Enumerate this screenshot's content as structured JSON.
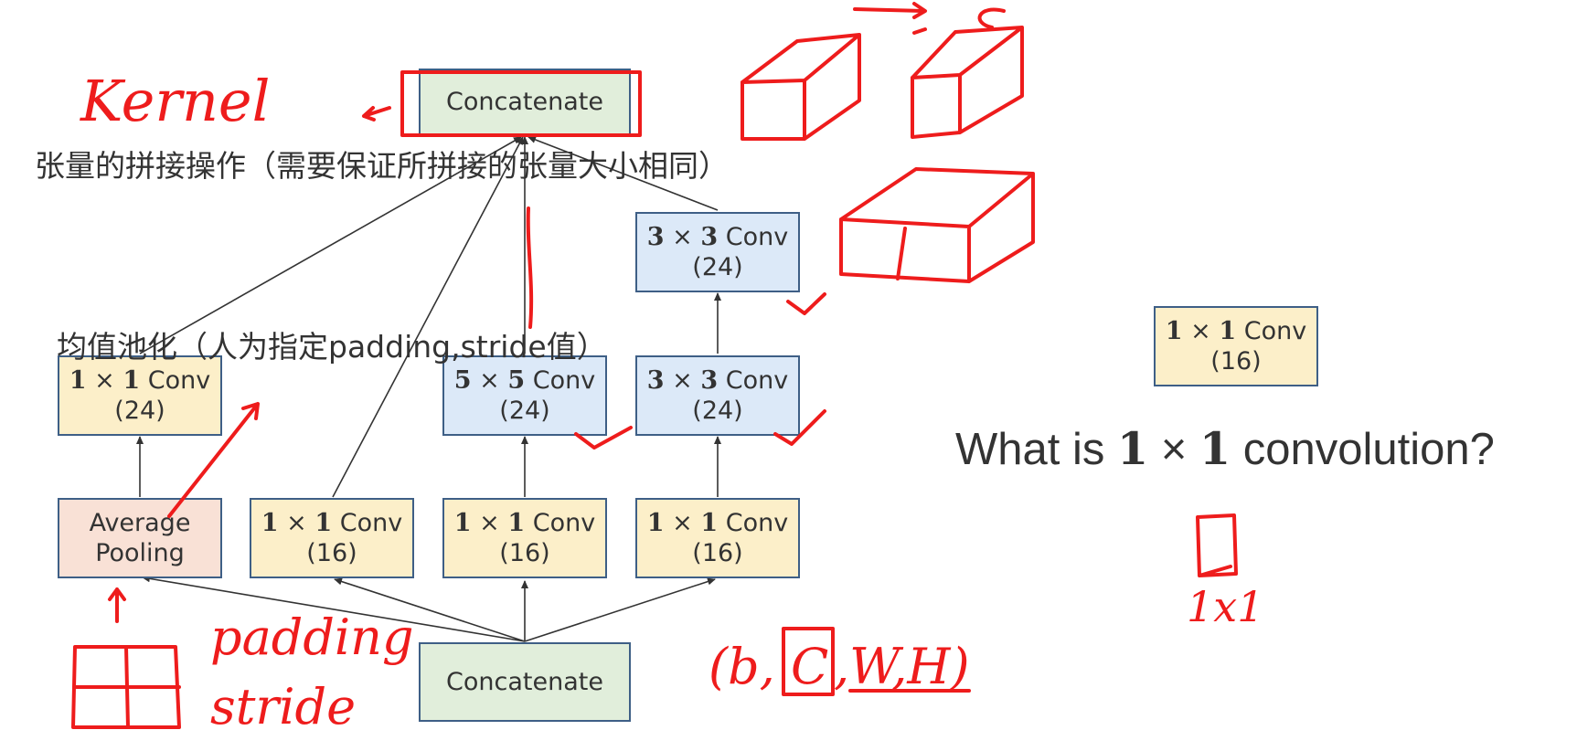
{
  "diagram": {
    "top_concat": "Concatenate",
    "bottom_concat": "Concatenate",
    "branch1_conv": {
      "num_a": "1",
      "num_b": "1",
      "label": "Conv",
      "channels": "(24)"
    },
    "avg_pool": {
      "line1": "Average",
      "line2": "Pooling"
    },
    "branch2_conv": {
      "num_a": "1",
      "num_b": "1",
      "label": "Conv",
      "channels": "(16)"
    },
    "branch3_conv1": {
      "num_a": "1",
      "num_b": "1",
      "label": "Conv",
      "channels": "(16)"
    },
    "branch3_conv5": {
      "num_a": "5",
      "num_b": "5",
      "label": "Conv",
      "channels": "(24)"
    },
    "branch4_conv1": {
      "num_a": "1",
      "num_b": "1",
      "label": "Conv",
      "channels": "(16)"
    },
    "branch4_conv3a": {
      "num_a": "3",
      "num_b": "3",
      "label": "Conv",
      "channels": "(24)"
    },
    "branch4_conv3b": {
      "num_a": "3",
      "num_b": "3",
      "label": "Conv",
      "channels": "(24)"
    },
    "side_conv": {
      "num_a": "1",
      "num_b": "1",
      "label": "Conv",
      "channels": "(16)"
    }
  },
  "notes": {
    "concat_note": "张量的拼接操作（需要保证所拼接的张量大小相同）",
    "pool_note": "均值池化（人为指定padding,stride值）"
  },
  "question": {
    "prefix": "What is",
    "num_a": "1",
    "num_b": "1",
    "suffix": "convolution?"
  },
  "handwriting": {
    "kernel": "Kernel",
    "padding": "padding",
    "stride": "stride",
    "tensor_shape_b": "(b,",
    "tensor_shape_c": "C",
    "tensor_shape_wh": ",W,H)",
    "one_by_one": "1x1"
  },
  "colors": {
    "green_fill": "#e1eedb",
    "yellow_fill": "#fcefc9",
    "blue_fill": "#dce9f8",
    "pink_fill": "#f9e1d6",
    "border": "#3e5f86",
    "annotation_red": "#ee1c1c"
  }
}
